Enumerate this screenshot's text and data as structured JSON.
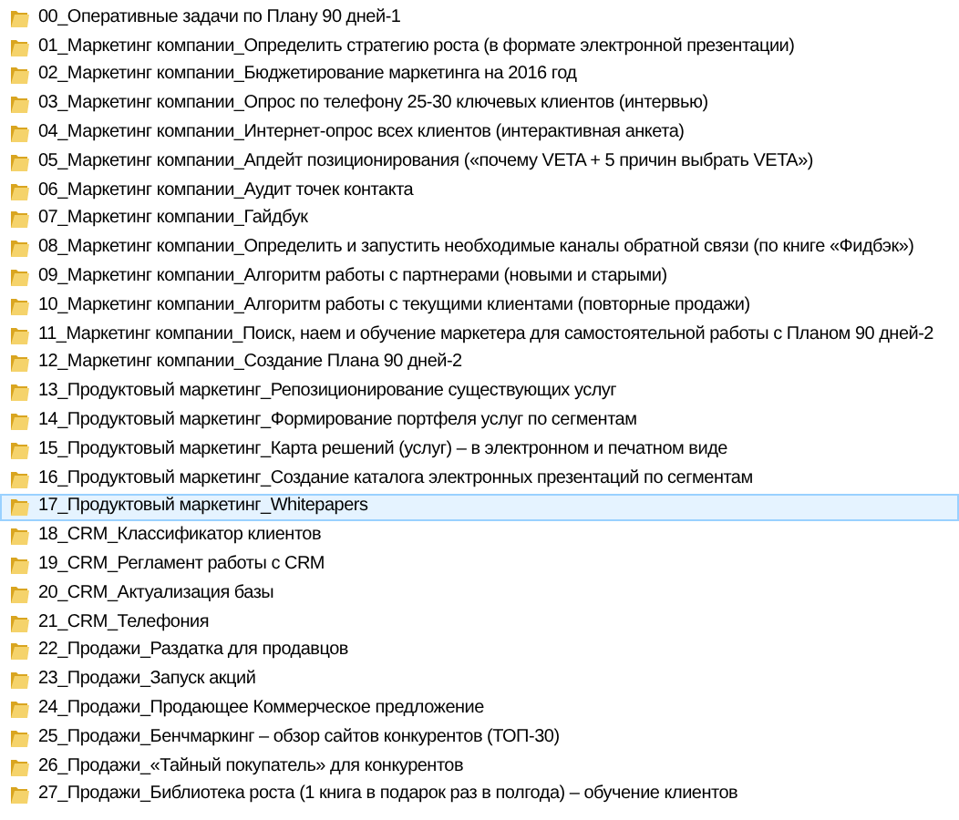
{
  "folders": [
    {
      "name": "00_Оперативные задачи по Плану 90 дней-1",
      "selected": false
    },
    {
      "name": "01_Маркетинг компании_Определить стратегию роста (в формате электронной презентации)",
      "selected": false
    },
    {
      "name": "02_Маркетинг компании_Бюджетирование маркетинга на 2016 год",
      "selected": false
    },
    {
      "name": "03_Маркетинг компании_Опрос по телефону 25-30 ключевых клиентов (интервью)",
      "selected": false
    },
    {
      "name": "04_Маркетинг компании_Интернет-опрос всех клиентов (интерактивная анкета)",
      "selected": false
    },
    {
      "name": "05_Маркетинг компании_Апдейт позиционирования («почему VETA + 5 причин выбрать VETA»)",
      "selected": false
    },
    {
      "name": "06_Маркетинг компании_Аудит точек контакта",
      "selected": false
    },
    {
      "name": "07_Маркетинг компании_Гайдбук",
      "selected": false
    },
    {
      "name": "08_Маркетинг компании_Определить и запустить необходимые каналы обратной связи (по книге «Фидбэк»)",
      "selected": false
    },
    {
      "name": "09_Маркетинг компании_Алгоритм работы с партнерами (новыми и старыми)",
      "selected": false
    },
    {
      "name": "10_Маркетинг компании_Алгоритм работы с текущими клиентами (повторные продажи)",
      "selected": false
    },
    {
      "name": "11_Маркетинг компании_Поиск, наем и обучение маркетера для самостоятельной работы с Планом 90 дней-2",
      "selected": false
    },
    {
      "name": "12_Маркетинг компании_Создание Плана 90 дней-2",
      "selected": false
    },
    {
      "name": "13_Продуктовый маркетинг_Репозиционирование существующих услуг",
      "selected": false
    },
    {
      "name": "14_Продуктовый маркетинг_Формирование портфеля услуг по сегментам",
      "selected": false
    },
    {
      "name": "15_Продуктовый маркетинг_Карта решений (услуг) – в электронном и печатном виде",
      "selected": false
    },
    {
      "name": "16_Продуктовый маркетинг_Создание каталога электронных презентаций по сегментам",
      "selected": false
    },
    {
      "name": "17_Продуктовый маркетинг_Whitepapers",
      "selected": true
    },
    {
      "name": "18_CRM_Классификатор клиентов",
      "selected": false
    },
    {
      "name": "19_CRM_Регламент работы с CRM",
      "selected": false
    },
    {
      "name": "20_CRM_Актуализация базы",
      "selected": false
    },
    {
      "name": "21_CRM_Телефония",
      "selected": false
    },
    {
      "name": "22_Продажи_Раздатка для продавцов",
      "selected": false
    },
    {
      "name": "23_Продажи_Запуск акций",
      "selected": false
    },
    {
      "name": "24_Продажи_Продающее Коммерческое предложение",
      "selected": false
    },
    {
      "name": "25_Продажи_Бенчмаркинг – обзор сайтов конкурентов (ТОП-30)",
      "selected": false
    },
    {
      "name": "26_Продажи_«Тайный покупатель» для конкурентов",
      "selected": false
    },
    {
      "name": "27_Продажи_Библиотека роста (1 книга в подарок раз в полгода) – обучение клиентов",
      "selected": false
    }
  ]
}
